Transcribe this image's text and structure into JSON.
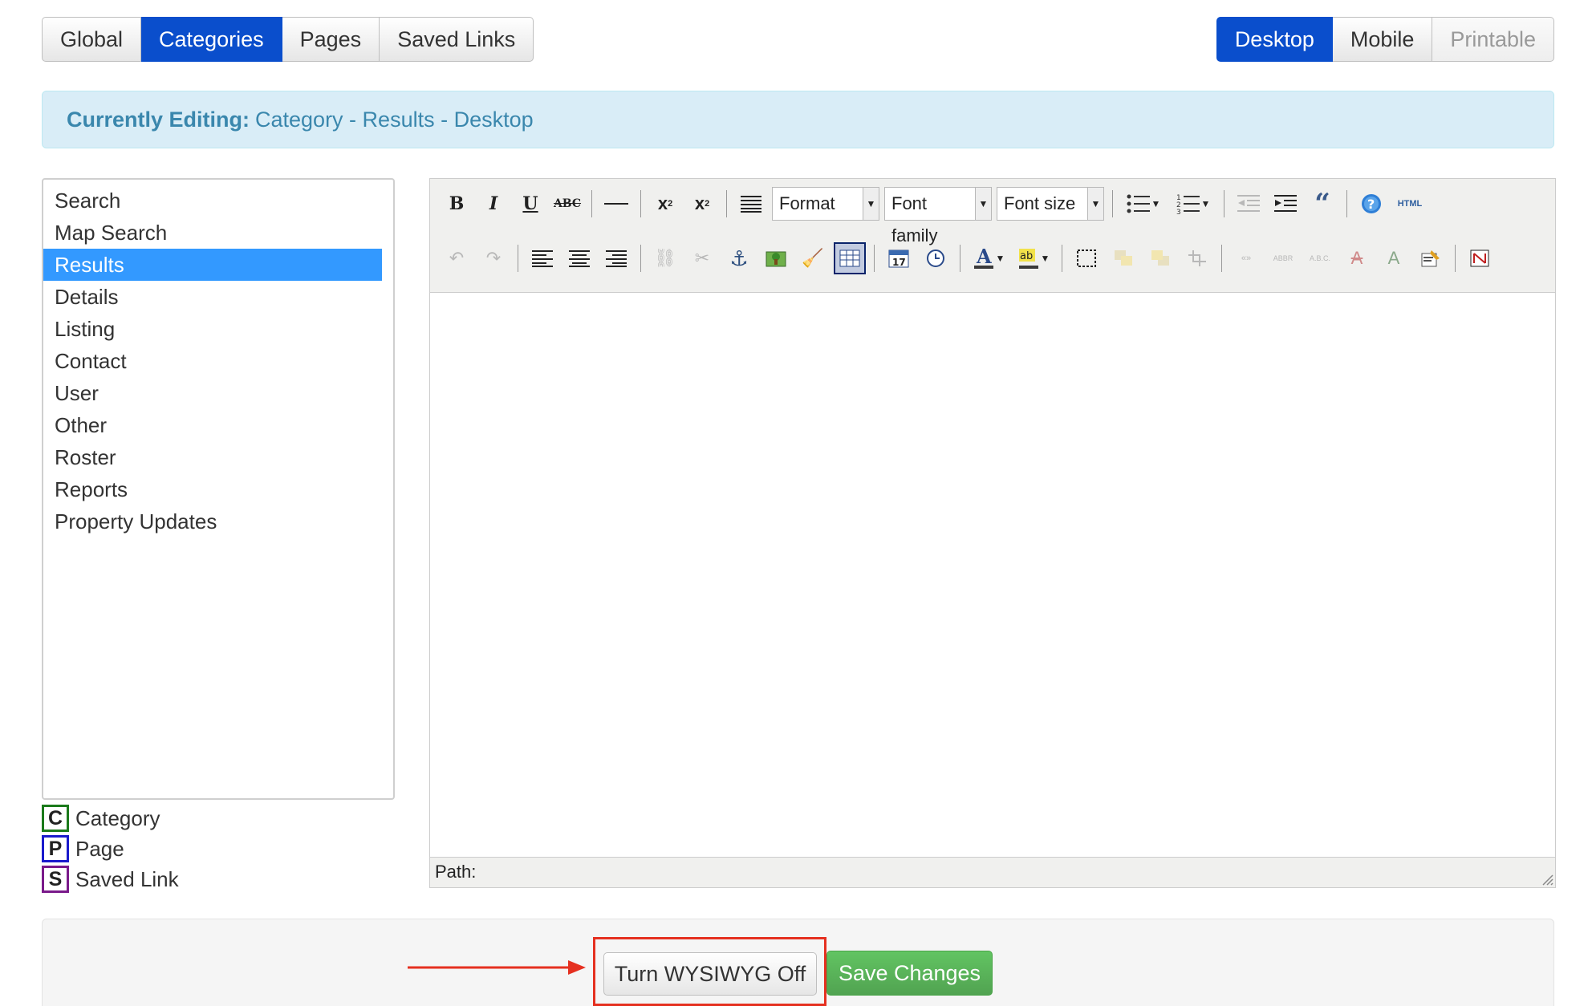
{
  "top_tabs_left": [
    {
      "label": "Global"
    },
    {
      "label": "Categories",
      "active": true
    },
    {
      "label": "Pages"
    },
    {
      "label": "Saved Links"
    }
  ],
  "top_tabs_right": [
    {
      "label": "Desktop",
      "active": true
    },
    {
      "label": "Mobile"
    },
    {
      "label": "Printable",
      "disabled": true
    }
  ],
  "banner": {
    "label": "Currently Editing:",
    "value": "Category - Results - Desktop"
  },
  "sidebar": {
    "items": [
      {
        "label": "Search"
      },
      {
        "label": "Map Search"
      },
      {
        "label": "Results",
        "selected": true
      },
      {
        "label": "Details"
      },
      {
        "label": "Listing"
      },
      {
        "label": "Contact"
      },
      {
        "label": "User"
      },
      {
        "label": "Other"
      },
      {
        "label": "Roster"
      },
      {
        "label": "Reports"
      },
      {
        "label": "Property Updates"
      }
    ]
  },
  "legend": [
    {
      "letter": "C",
      "label": "Category",
      "color": "#1b7a1b"
    },
    {
      "letter": "P",
      "label": "Page",
      "color": "#1a1acc"
    },
    {
      "letter": "S",
      "label": "Saved Link",
      "color": "#7a1a8a"
    }
  ],
  "editor": {
    "toolbar": {
      "format_select": "Format",
      "font_family_select": "Font family",
      "font_size_select": "Font size",
      "html_button": "HTML"
    },
    "status_path": "Path:"
  },
  "actions": {
    "wysiwyg_toggle": "Turn WYSIWYG Off",
    "save": "Save Changes"
  },
  "colors": {
    "primary": "#0a4ecc",
    "banner_bg": "#d9edf7",
    "banner_text": "#3a87ad",
    "selected_item": "#3399ff",
    "save_green": "#5bb75b",
    "annotation_red": "#e53020"
  }
}
